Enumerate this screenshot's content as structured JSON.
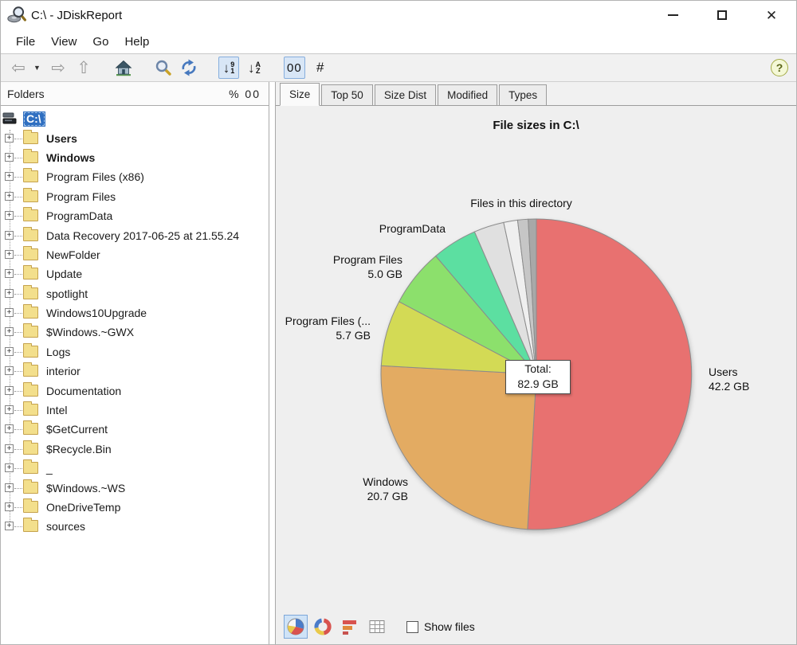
{
  "window": {
    "title": "C:\\ - JDiskReport"
  },
  "menu": {
    "items": [
      "File",
      "View",
      "Go",
      "Help"
    ]
  },
  "toolbar": {
    "sort1_top": "9",
    "sort1_bottom": "1",
    "sort2_top": "A",
    "sort2_bottom": "Z",
    "zero_label": "00",
    "hash_label": "#",
    "help_label": "?"
  },
  "folders_panel": {
    "header": "Folders",
    "header_right": "% 00",
    "tree": {
      "root": "C:\\",
      "items": [
        {
          "label": "Users",
          "bold": true
        },
        {
          "label": "Windows",
          "bold": true
        },
        {
          "label": "Program Files (x86)",
          "bold": false
        },
        {
          "label": "Program Files",
          "bold": false
        },
        {
          "label": "ProgramData",
          "bold": false
        },
        {
          "label": "Data Recovery 2017-06-25 at 21.55.24",
          "bold": false
        },
        {
          "label": "NewFolder",
          "bold": false
        },
        {
          "label": "Update",
          "bold": false
        },
        {
          "label": "spotlight",
          "bold": false
        },
        {
          "label": "Windows10Upgrade",
          "bold": false
        },
        {
          "label": "$Windows.~GWX",
          "bold": false
        },
        {
          "label": "Logs",
          "bold": false
        },
        {
          "label": "interior",
          "bold": false
        },
        {
          "label": "Documentation",
          "bold": false
        },
        {
          "label": "Intel",
          "bold": false
        },
        {
          "label": "$GetCurrent",
          "bold": false
        },
        {
          "label": "$Recycle.Bin",
          "bold": false
        },
        {
          "label": "_",
          "bold": false
        },
        {
          "label": "$Windows.~WS",
          "bold": false
        },
        {
          "label": "OneDriveTemp",
          "bold": false
        },
        {
          "label": "sources",
          "bold": false
        }
      ]
    }
  },
  "tabs": {
    "items": [
      "Size",
      "Top 50",
      "Size Dist",
      "Modified",
      "Types"
    ],
    "active": "Size"
  },
  "chart_data": {
    "type": "pie",
    "title": "File sizes in C:\\",
    "unit": "GB",
    "total_label": "Total:",
    "total_value": "82.9 GB",
    "start_angle_deg": 0,
    "direction": "clockwise",
    "legend": "none",
    "slices": [
      {
        "name": "Users",
        "value": 42.2,
        "size_label": "42.2 GB",
        "color": "#e87170",
        "label_visible": true
      },
      {
        "name": "Windows",
        "value": 20.7,
        "size_label": "20.7 GB",
        "color": "#e3ab62",
        "label_visible": true
      },
      {
        "name": "Program Files (...",
        "value": 5.7,
        "size_label": "5.7 GB",
        "color": "#d3da55",
        "label_visible": true
      },
      {
        "name": "Program Files",
        "value": 5.0,
        "size_label": "5.0 GB",
        "color": "#8ce06c",
        "label_visible": true
      },
      {
        "name": "ProgramData",
        "value": 3.9,
        "size_label": "",
        "color": "#5cdfa1",
        "label_visible": true
      },
      {
        "name": "",
        "value": 2.6,
        "size_label": "",
        "color": "#e0e0e0",
        "label_visible": false
      },
      {
        "name": "",
        "value": 1.2,
        "size_label": "",
        "color": "#efefef",
        "label_visible": false
      },
      {
        "name": "Files in this directory",
        "value": 0.9,
        "size_label": "",
        "color": "#c6c6c6",
        "label_visible": true
      },
      {
        "name": "",
        "value": 0.7,
        "size_label": "",
        "color": "#a8a8a8",
        "label_visible": false
      }
    ]
  },
  "bottom_bar": {
    "show_files_label": "Show files",
    "show_files_checked": false
  }
}
